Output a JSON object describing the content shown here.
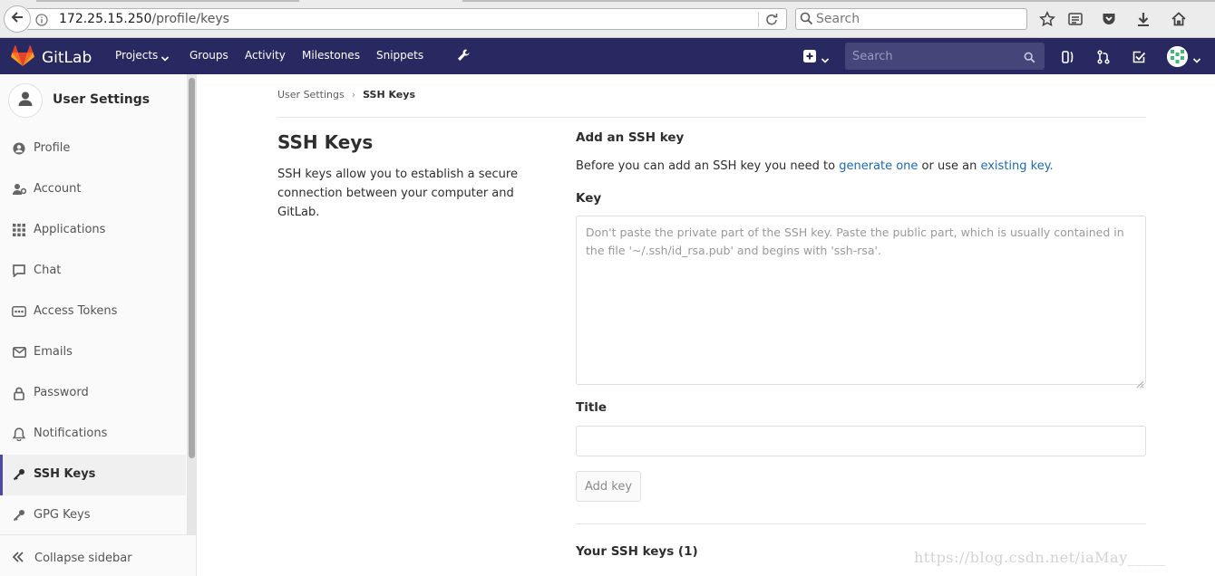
{
  "browser": {
    "url_host": "172.25.15.250",
    "url_path": "/profile/keys",
    "search_placeholder": "Search"
  },
  "nav": {
    "brand": "GitLab",
    "links": [
      "Projects",
      "Groups",
      "Activity",
      "Milestones",
      "Snippets"
    ],
    "search_placeholder": "Search",
    "brand_color": "#292961"
  },
  "sidebar": {
    "title": "User Settings",
    "items": [
      {
        "label": "Profile",
        "icon": "user-circle-icon"
      },
      {
        "label": "Account",
        "icon": "account-gears-icon"
      },
      {
        "label": "Applications",
        "icon": "grid-icon"
      },
      {
        "label": "Chat",
        "icon": "chat-icon"
      },
      {
        "label": "Access Tokens",
        "icon": "ellipsis-box-icon"
      },
      {
        "label": "Emails",
        "icon": "envelope-icon"
      },
      {
        "label": "Password",
        "icon": "lock-icon"
      },
      {
        "label": "Notifications",
        "icon": "bell-icon"
      },
      {
        "label": "SSH Keys",
        "icon": "key-icon",
        "active": true
      },
      {
        "label": "GPG Keys",
        "icon": "key-icon"
      }
    ],
    "collapse_label": "Collapse sidebar"
  },
  "breadcrumb": {
    "parent": "User Settings",
    "current": "SSH Keys"
  },
  "page": {
    "title": "SSH Keys",
    "description": "SSH keys allow you to establish a secure connection between your computer and GitLab."
  },
  "form": {
    "section_title": "Add an SSH key",
    "intro_before": "Before you can add an SSH key you need to ",
    "intro_link1": "generate one",
    "intro_mid": " or use an ",
    "intro_link2": "existing key.",
    "key_label": "Key",
    "key_placeholder": "Don't paste the private part of the SSH key. Paste the public part, which is usually contained in the file '~/.ssh/id_rsa.pub' and begins with 'ssh-rsa'.",
    "title_label": "Title",
    "title_value": "",
    "submit_label": "Add key",
    "link_color": "#1b69b6"
  },
  "keys_section": {
    "heading": "Your SSH keys (1)"
  },
  "watermark": "https://blog.csdn.net/iaMay_____"
}
